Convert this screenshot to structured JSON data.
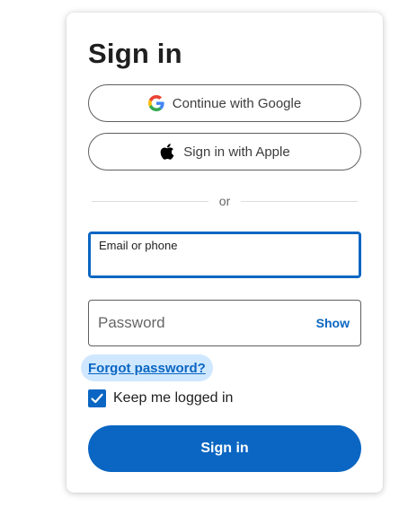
{
  "title": "Sign in",
  "sso": {
    "google_label": "Continue with Google",
    "apple_label": "Sign in with Apple"
  },
  "divider_text": "or",
  "email": {
    "label": "Email or phone",
    "value": ""
  },
  "password": {
    "placeholder": "Password",
    "show_label": "Show"
  },
  "forgot_label": "Forgot password?",
  "keep_logged_in": {
    "label": "Keep me logged in",
    "checked": true
  },
  "submit_label": "Sign in",
  "colors": {
    "accent": "#0a66c2",
    "forgot_highlight": "#d0e8ff"
  }
}
